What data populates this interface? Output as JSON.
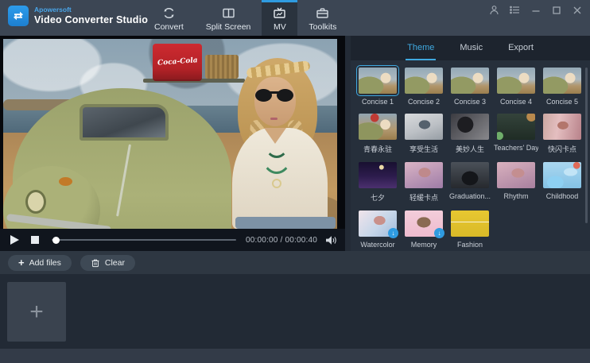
{
  "app": {
    "brand": "Apowersoft",
    "title": "Video Converter Studio"
  },
  "titlebar": {
    "tabs": [
      {
        "label": "Convert",
        "active": false
      },
      {
        "label": "Split Screen",
        "active": false
      },
      {
        "label": "MV",
        "active": true
      },
      {
        "label": "Toolkits",
        "active": false
      }
    ]
  },
  "colors": {
    "accent": "#2f9be0",
    "titlebar_bg": "#3c4654",
    "panel_bg": "#262f3b",
    "selected_border": "#3fa9e0",
    "cooler_red": "#c5262b",
    "car_olive": "#9ba26c"
  },
  "player": {
    "time": "00:00:00 / 00:00:40",
    "progress_pct": 0,
    "scene": {
      "cooler_text": "Coca-Cola"
    }
  },
  "toolbar": {
    "add_files_label": "Add files",
    "clear_label": "Clear"
  },
  "right_panel": {
    "tabs": [
      {
        "label": "Theme",
        "active": true
      },
      {
        "label": "Music",
        "active": false
      },
      {
        "label": "Export",
        "active": false
      }
    ],
    "themes": [
      {
        "label": "Concise 1",
        "selected": true,
        "art": "radial-gradient(circle at 71% 40%, #ecdcc2 0 16%, transparent 17%), radial-gradient(ellipse at 28% 72%, #939a63 0 36%, transparent 37%), linear-gradient(180deg,#93a8b6 0%,#adbac1 45%,#b1966b 70%,#9b7e4d 100%)"
      },
      {
        "label": "Concise 2",
        "art": "radial-gradient(circle at 71% 40%, #ecdcc2 0 16%, transparent 17%), radial-gradient(ellipse at 28% 72%, #939a63 0 36%, transparent 37%), linear-gradient(180deg,#93a8b6 0%,#adbac1 45%,#b1966b 70%,#9b7e4d 100%)"
      },
      {
        "label": "Concise 3",
        "art": "radial-gradient(circle at 71% 40%, #ecdcc2 0 16%, transparent 17%), radial-gradient(ellipse at 28% 72%, #939a63 0 36%, transparent 37%), linear-gradient(180deg,#93a8b6 0%,#adbac1 45%,#b1966b 70%,#9b7e4d 100%)"
      },
      {
        "label": "Concise 4",
        "art": "radial-gradient(circle at 71% 40%, #ecdcc2 0 16%, transparent 17%), radial-gradient(ellipse at 28% 72%, #939a63 0 36%, transparent 37%), linear-gradient(180deg,#93a8b6 0%,#adbac1 45%,#b1966b 70%,#9b7e4d 100%)"
      },
      {
        "label": "Concise 5",
        "art": "radial-gradient(circle at 71% 40%, #ecdcc2 0 16%, transparent 17%), radial-gradient(ellipse at 28% 72%, #939a63 0 36%, transparent 37%), linear-gradient(180deg,#93a8b6 0%,#adbac1 45%,#b1966b 70%,#9b7e4d 100%)"
      },
      {
        "label": "青春永驻",
        "art": "radial-gradient(circle at 42% 16%, #bf3a34 0 13%, transparent 14%), radial-gradient(circle at 70% 42%, #ecdcc2 0 16%, transparent 17%), radial-gradient(ellipse at 26% 70%, #8e955e 0 36%, transparent 37%), linear-gradient(180deg,#92a5b2 0%,#b29971 60%,#9a7d4c 100%)"
      },
      {
        "label": "享受生活",
        "art": "radial-gradient(ellipse at 52% 42%, #55616d 0 20%, transparent 21%), linear-gradient(160deg,#d8dadc 0%,#bcc0c5 55%,#969da4 100%)"
      },
      {
        "label": "美妙人生",
        "art": "radial-gradient(circle at 38% 42%, #1d1d21 0 28%, transparent 29%), linear-gradient(135deg,#3b3b41 0%,#88888c 100%)"
      },
      {
        "label": "Teachers' Day",
        "art": "radial-gradient(circle at 90% 12%, #b9894d 0 11%, transparent 12%), radial-gradient(circle at 6% 85%, #6fae6a 0 9%, transparent 10%), linear-gradient(180deg,#34433b 0%,#1f2c25 100%)"
      },
      {
        "label": "快闪卡点",
        "art": "radial-gradient(ellipse at 52% 45%, #b3766c 0 19%, transparent 20%), linear-gradient(100deg,#caa7a1 0%,#e4bec0 40%,#b8828a 100%)"
      },
      {
        "label": "七夕",
        "art": "radial-gradient(circle at 60% 20%, #ead9a6 0 7%, transparent 8%), linear-gradient(180deg,#181030 0%,#2d1c4d 55%,#4b306f 100%)"
      },
      {
        "label": "轻缓卡点",
        "art": "radial-gradient(ellipse at 52% 40%, #bf898b 0 21%, transparent 22%), linear-gradient(160deg,#dab4c5 0%,#9e7ca7 100%)"
      },
      {
        "label": "Graduation...",
        "art": "radial-gradient(ellipse at 50% 62%, #14161a 0 30%, transparent 31%), linear-gradient(180deg,#4b5159 0%,#26292e 100%)"
      },
      {
        "label": "Rhythm",
        "art": "radial-gradient(ellipse at 55% 42%, #c48e90 0 21%, transparent 22%), linear-gradient(160deg,#d9b1be 0%,#a8809f 100%)"
      },
      {
        "label": "Childhood",
        "art": "radial-gradient(circle at 88% 13%, #e06a58 0 8%, transparent 9%), radial-gradient(ellipse at 32% 78%, #8ed0f2 0 22%, transparent 23%), radial-gradient(ellipse at 72% 38%, #c2e4f6 0 17%, transparent 18%), linear-gradient(180deg,#aad7f0 0%,#84c2e5 100%)"
      },
      {
        "label": "Watercolor",
        "download": true,
        "art": "radial-gradient(ellipse at 55% 38%, #c9908a 0 19%, transparent 20%), linear-gradient(135deg,#f0e4ea 0%,#c6d6e9 55%,#9fb9d9 100%)"
      },
      {
        "label": "Memory",
        "download": true,
        "art": "radial-gradient(ellipse at 50% 45%, #8a6a52 0 25%, transparent 26%), linear-gradient(180deg,#f3cdda 0%,#eebbce 100%)"
      },
      {
        "label": "Fashion",
        "art": "linear-gradient(180deg, transparent 42%, rgba(255,255,255,.8) 43% 45%, transparent 46%), linear-gradient(180deg,#e7c731 0%,#d9ba28 100%)"
      }
    ]
  }
}
